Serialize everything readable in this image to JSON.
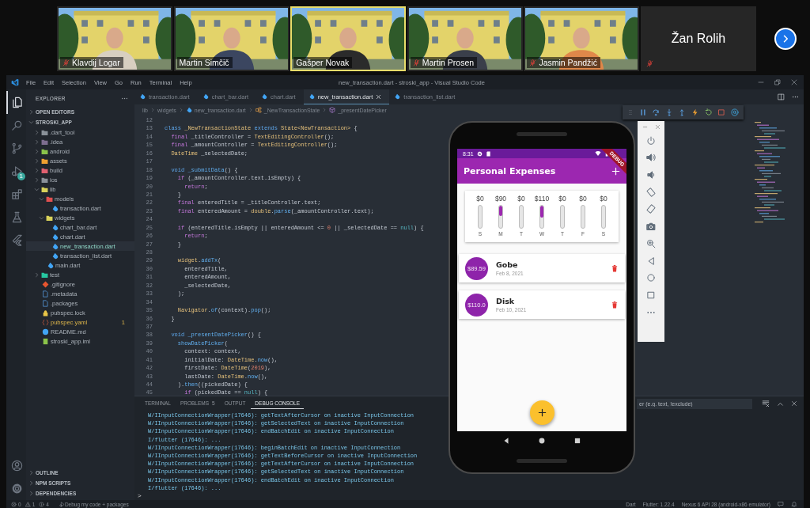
{
  "meeting": {
    "participants": [
      {
        "name": "Klavdij Logar",
        "muted": true,
        "speaking": false,
        "video": true
      },
      {
        "name": "Martin Simčič",
        "muted": false,
        "speaking": false,
        "video": true
      },
      {
        "name": "Gašper Novak",
        "muted": false,
        "speaking": true,
        "video": true
      },
      {
        "name": "Martin Prosen",
        "muted": true,
        "speaking": false,
        "video": true
      },
      {
        "name": "Jasmin Pandžić",
        "muted": true,
        "speaking": false,
        "video": true
      },
      {
        "name": "Žan Rolih",
        "muted": true,
        "speaking": false,
        "video": false
      }
    ]
  },
  "vscode": {
    "menu": [
      "File",
      "Edit",
      "Selection",
      "View",
      "Go",
      "Run",
      "Terminal",
      "Help"
    ],
    "title": "new_transaction.dart - stroski_app - Visual Studio Code",
    "activity": [
      {
        "kind": "files",
        "selected": true
      },
      {
        "kind": "search",
        "selected": false
      },
      {
        "kind": "branch",
        "selected": false
      },
      {
        "kind": "debug",
        "selected": false,
        "badge": "1"
      },
      {
        "kind": "blocks",
        "selected": false
      },
      {
        "kind": "flask",
        "selected": false
      },
      {
        "kind": "logo",
        "selected": false
      }
    ],
    "activity_bottom": [
      {
        "kind": "person"
      },
      {
        "kind": "gear"
      }
    ],
    "explorer": {
      "title": "EXPLORER",
      "sections": [
        {
          "label": "OPEN EDITORS",
          "expanded": false
        },
        {
          "label": "STROSKI_APP",
          "expanded": true
        }
      ],
      "tree": [
        {
          "label": ".dart_tool",
          "kind": "folder",
          "color": "#8a9199",
          "expanded": false,
          "selected": false,
          "warning": false
        },
        {
          "label": ".idea",
          "kind": "folder",
          "color": "#7d6d8f",
          "expanded": false,
          "selected": false,
          "warning": false
        },
        {
          "label": "android",
          "kind": "folder",
          "color": "#8bc34a",
          "expanded": false,
          "selected": false,
          "warning": false
        },
        {
          "label": "assets",
          "kind": "folder",
          "color": "#f0a030",
          "expanded": false,
          "selected": false,
          "warning": false
        },
        {
          "label": "build",
          "kind": "folder",
          "color": "#e06070",
          "expanded": false,
          "selected": false,
          "warning": false
        },
        {
          "label": "ios",
          "kind": "folder",
          "color": "#8a9199",
          "expanded": false,
          "selected": false,
          "warning": false
        },
        {
          "label": "lib",
          "kind": "folder",
          "color": "#d9d25a",
          "expanded": true,
          "selected": false,
          "warning": false,
          "children": [
            {
              "label": "models",
              "kind": "folder",
              "color": "#e05050",
              "expanded": true,
              "selected": false,
              "warning": false,
              "children": [
                {
                  "label": "transaction.dart",
                  "kind": "dart",
                  "selected": false,
                  "warning": false
                }
              ]
            },
            {
              "label": "widgets",
              "kind": "folder",
              "color": "#d9d25a",
              "expanded": true,
              "selected": false,
              "warning": false,
              "children": [
                {
                  "label": "chart_bar.dart",
                  "kind": "dart",
                  "selected": false,
                  "warning": false
                },
                {
                  "label": "chart.dart",
                  "kind": "dart",
                  "selected": false,
                  "warning": false
                },
                {
                  "label": "new_transaction.dart",
                  "kind": "dart",
                  "selected": true,
                  "warning": false
                },
                {
                  "label": "transaction_list.dart",
                  "kind": "dart",
                  "selected": false,
                  "warning": false
                }
              ]
            },
            {
              "label": "main.dart",
              "kind": "dart",
              "selected": false,
              "warning": false
            }
          ]
        },
        {
          "label": "test",
          "kind": "folder",
          "color": "#26c6a0",
          "expanded": false,
          "selected": false,
          "warning": false
        },
        {
          "label": ".gitignore",
          "kind": "git",
          "selected": false,
          "warning": false
        },
        {
          "label": ".metadata",
          "kind": "doc",
          "selected": false,
          "warning": false
        },
        {
          "label": ".packages",
          "kind": "doc",
          "selected": false,
          "warning": false
        },
        {
          "label": "pubspec.lock",
          "kind": "lock",
          "selected": false,
          "warning": false
        },
        {
          "label": "pubspec.yaml",
          "kind": "yaml",
          "selected": false,
          "warning": true,
          "badge": "1"
        },
        {
          "label": "README.md",
          "kind": "info",
          "selected": false,
          "warning": false
        },
        {
          "label": "stroski_app.iml",
          "kind": "iml",
          "selected": false,
          "warning": false
        }
      ],
      "bottom_sections": [
        {
          "label": "OUTLINE",
          "expanded": false
        },
        {
          "label": "NPM SCRIPTS",
          "expanded": false
        },
        {
          "label": "DEPENDENCIES",
          "expanded": false
        }
      ]
    },
    "tabs": [
      {
        "label": "transaction.dart",
        "selected": false
      },
      {
        "label": "chart_bar.dart",
        "selected": false
      },
      {
        "label": "chart.dart",
        "selected": false
      },
      {
        "label": "new_transaction.dart",
        "selected": true
      },
      {
        "label": "transaction_list.dart",
        "selected": false
      }
    ],
    "breadcrumb": [
      {
        "label": "lib",
        "kind": "plain"
      },
      {
        "label": "widgets",
        "kind": "plain"
      },
      {
        "label": "new_transaction.dart",
        "kind": "file"
      },
      {
        "label": "_NewTransactionState",
        "kind": "class"
      },
      {
        "label": "_presentDatePicker",
        "kind": "method"
      }
    ],
    "code": [
      {
        "number": "12"
      },
      {
        "number": "13",
        "tokens": [
          {
            "text": "class ",
            "kind": "kw"
          },
          {
            "text": "_NewTransactionState ",
            "kind": "type"
          },
          {
            "text": "extends ",
            "kind": "kw"
          },
          {
            "text": "State<NewTransaction> ",
            "kind": "type"
          },
          {
            "text": "{",
            "kind": "p"
          }
        ]
      },
      {
        "number": "14",
        "tokens": [
          {
            "text": "  final ",
            "kind": "ctl"
          },
          {
            "text": "_titleController = ",
            "kind": "p"
          },
          {
            "text": "TextEditingController",
            "kind": "type"
          },
          {
            "text": "();",
            "kind": "p"
          }
        ]
      },
      {
        "number": "15",
        "tokens": [
          {
            "text": "  final ",
            "kind": "ctl"
          },
          {
            "text": "_amountController = ",
            "kind": "p"
          },
          {
            "text": "TextEditingController",
            "kind": "type"
          },
          {
            "text": "();",
            "kind": "p"
          }
        ]
      },
      {
        "number": "16",
        "tokens": [
          {
            "text": "  DateTime ",
            "kind": "type"
          },
          {
            "text": "_selectedDate;",
            "kind": "p"
          }
        ]
      },
      {
        "number": "17"
      },
      {
        "number": "18",
        "tokens": [
          {
            "text": "  void ",
            "kind": "kw"
          },
          {
            "text": "_submitData",
            "kind": "fn"
          },
          {
            "text": "() {",
            "kind": "p"
          }
        ]
      },
      {
        "number": "19",
        "tokens": [
          {
            "text": "    if ",
            "kind": "ctl"
          },
          {
            "text": "(_amountController.text.isEmpty) {",
            "kind": "p"
          }
        ]
      },
      {
        "number": "20",
        "tokens": [
          {
            "text": "      return",
            "kind": "ctl"
          },
          {
            "text": ";",
            "kind": "p"
          }
        ]
      },
      {
        "number": "21",
        "tokens": [
          {
            "text": "    }",
            "kind": "p"
          }
        ]
      },
      {
        "number": "22",
        "tokens": [
          {
            "text": "    final ",
            "kind": "ctl"
          },
          {
            "text": "enteredTitle = _titleController.text;",
            "kind": "p"
          }
        ]
      },
      {
        "number": "23",
        "tokens": [
          {
            "text": "    final ",
            "kind": "ctl"
          },
          {
            "text": "enteredAmount = ",
            "kind": "p"
          },
          {
            "text": "double",
            "kind": "type"
          },
          {
            "text": ".",
            "kind": "p"
          },
          {
            "text": "parse",
            "kind": "fn"
          },
          {
            "text": "(_amountController.text);",
            "kind": "p"
          }
        ]
      },
      {
        "number": "24"
      },
      {
        "number": "25",
        "tokens": [
          {
            "text": "    if ",
            "kind": "ctl"
          },
          {
            "text": "(enteredTitle.isEmpty || enteredAmount <= ",
            "kind": "p"
          },
          {
            "text": "0",
            "kind": "num"
          },
          {
            "text": " || _selectedDate == ",
            "kind": "p"
          },
          {
            "text": "null",
            "kind": "lit"
          },
          {
            "text": ") {",
            "kind": "p"
          }
        ]
      },
      {
        "number": "26",
        "tokens": [
          {
            "text": "      return",
            "kind": "ctl"
          },
          {
            "text": ";",
            "kind": "p"
          }
        ]
      },
      {
        "number": "27",
        "tokens": [
          {
            "text": "    }",
            "kind": "p"
          }
        ]
      },
      {
        "number": "28"
      },
      {
        "number": "29",
        "tokens": [
          {
            "text": "    widget",
            "kind": "type"
          },
          {
            "text": ".",
            "kind": "p"
          },
          {
            "text": "addTx",
            "kind": "fn"
          },
          {
            "text": "(",
            "kind": "p"
          }
        ]
      },
      {
        "number": "30",
        "tokens": [
          {
            "text": "      enteredTitle,",
            "kind": "p"
          }
        ]
      },
      {
        "number": "31",
        "tokens": [
          {
            "text": "      enteredAmount,",
            "kind": "p"
          }
        ]
      },
      {
        "number": "32",
        "tokens": [
          {
            "text": "      _selectedDate,",
            "kind": "p"
          }
        ]
      },
      {
        "number": "33",
        "tokens": [
          {
            "text": "    );",
            "kind": "p"
          }
        ]
      },
      {
        "number": "34"
      },
      {
        "number": "35",
        "tokens": [
          {
            "text": "    Navigator",
            "kind": "type"
          },
          {
            "text": ".",
            "kind": "p"
          },
          {
            "text": "of",
            "kind": "fn"
          },
          {
            "text": "(context).",
            "kind": "p"
          },
          {
            "text": "pop",
            "kind": "fn"
          },
          {
            "text": "();",
            "kind": "p"
          }
        ]
      },
      {
        "number": "36",
        "tokens": [
          {
            "text": "  }",
            "kind": "p"
          }
        ]
      },
      {
        "number": "37"
      },
      {
        "number": "38",
        "tokens": [
          {
            "text": "  void ",
            "kind": "kw"
          },
          {
            "text": "_presentDatePicker",
            "kind": "fn"
          },
          {
            "text": "() {",
            "kind": "p"
          }
        ]
      },
      {
        "number": "39",
        "tokens": [
          {
            "text": "    showDatePicker",
            "kind": "fn"
          },
          {
            "text": "(",
            "kind": "p"
          }
        ]
      },
      {
        "number": "40",
        "tokens": [
          {
            "text": "      context: context,",
            "kind": "p"
          }
        ]
      },
      {
        "number": "41",
        "tokens": [
          {
            "text": "      initialDate: ",
            "kind": "p"
          },
          {
            "text": "DateTime",
            "kind": "type"
          },
          {
            "text": ".",
            "kind": "p"
          },
          {
            "text": "now",
            "kind": "fn"
          },
          {
            "text": "(),",
            "kind": "p"
          }
        ]
      },
      {
        "number": "42",
        "tokens": [
          {
            "text": "      firstDate: ",
            "kind": "p"
          },
          {
            "text": "DateTime",
            "kind": "type"
          },
          {
            "text": "(",
            "kind": "p"
          },
          {
            "text": "2019",
            "kind": "num"
          },
          {
            "text": "),",
            "kind": "p"
          }
        ]
      },
      {
        "number": "43",
        "tokens": [
          {
            "text": "      lastDate: ",
            "kind": "p"
          },
          {
            "text": "DateTime",
            "kind": "type"
          },
          {
            "text": ".",
            "kind": "p"
          },
          {
            "text": "now",
            "kind": "fn"
          },
          {
            "text": "(),",
            "kind": "p"
          }
        ]
      },
      {
        "number": "44",
        "tokens": [
          {
            "text": "    ).",
            "kind": "p"
          },
          {
            "text": "then",
            "kind": "fn"
          },
          {
            "text": "((pickedDate) {",
            "kind": "p"
          }
        ]
      },
      {
        "number": "45",
        "tokens": [
          {
            "text": "      if ",
            "kind": "ctl"
          },
          {
            "text": "(pickedDate == ",
            "kind": "p"
          },
          {
            "text": "null",
            "kind": "lit"
          },
          {
            "text": ") {",
            "kind": "p"
          }
        ]
      }
    ],
    "panel": {
      "tabs": [
        {
          "label": "TERMINAL",
          "selected": false
        },
        {
          "label": "PROBLEMS",
          "selected": false,
          "badge": "5"
        },
        {
          "label": "OUTPUT",
          "selected": false
        },
        {
          "label": "DEBUG CONSOLE",
          "selected": true
        }
      ],
      "filter_placeholder": "er (e.g. text, !exclude)",
      "lines": [
        "W/IInputConnectionWrapper(17646): getTextAfterCursor on inactive InputConnection",
        "W/IInputConnectionWrapper(17646): getSelectedText on inactive InputConnection",
        "W/IInputConnectionWrapper(17646): endBatchEdit on inactive InputConnection",
        "I/flutter (17646): ...",
        "W/IInputConnectionWrapper(17646): beginBatchEdit on inactive InputConnection",
        "W/IInputConnectionWrapper(17646): getTextBeforeCursor on inactive InputConnection",
        "W/IInputConnectionWrapper(17646): getTextAfterCursor on inactive InputConnection",
        "W/IInputConnectionWrapper(17646): getSelectedText on inactive InputConnection",
        "W/IInputConnectionWrapper(17646): endBatchEdit on inactive InputConnection",
        "I/flutter (17646): ..."
      ],
      "prompt": ">"
    },
    "status_bar": {
      "errors": "0",
      "warnings": "1",
      "infos": "4",
      "debug_mode": "Debug my code + packages",
      "right": [
        "Dart",
        "Flutter: 1.22.4",
        "Nexus 6 API 28 (android-x86 emulator)"
      ]
    }
  },
  "emulator": {
    "time": "8:31",
    "title": "Personal Expenses",
    "banner": "DEBUG",
    "bars": [
      {
        "amount": "$0",
        "day": "S",
        "level": 0
      },
      {
        "amount": "$90",
        "day": "M",
        "level": 0.45
      },
      {
        "amount": "$0",
        "day": "T",
        "level": 0
      },
      {
        "amount": "$110",
        "day": "W",
        "level": 0.55
      },
      {
        "amount": "$0",
        "day": "T",
        "level": 0
      },
      {
        "amount": "$0",
        "day": "F",
        "level": 0
      },
      {
        "amount": "$0",
        "day": "S",
        "level": 0
      }
    ],
    "transactions": [
      {
        "amount": "$89.59",
        "title": "Gobe",
        "date": "Feb 8, 2021"
      },
      {
        "amount": "$110.0",
        "title": "Disk",
        "date": "Feb 10, 2021"
      }
    ]
  }
}
